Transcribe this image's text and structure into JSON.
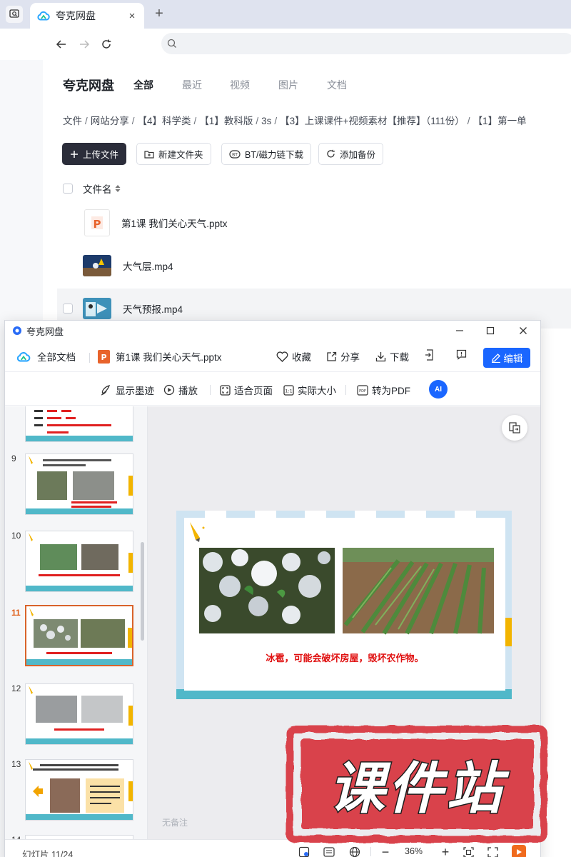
{
  "browser": {
    "tab_title": "夸克网盘",
    "tab_close": "×",
    "new_tab": "+"
  },
  "page": {
    "brand": "夸克网盘",
    "tabs": [
      "全部",
      "最近",
      "视频",
      "图片",
      "文档"
    ],
    "breadcrumb": [
      "文件",
      "网站分享",
      "【4】科学类",
      "【1】教科版",
      "3s",
      "【3】上课课件+视频素材【推荐】（111份）",
      "【1】第一单"
    ],
    "actions": {
      "upload": "上传文件",
      "new_folder": "新建文件夹",
      "bt": "BT/磁力链下载",
      "backup": "添加备份"
    },
    "file_header": "文件名",
    "files": [
      {
        "name": "第1课 我们关心天气.pptx",
        "type": "pptx"
      },
      {
        "name": "大气层.mp4",
        "type": "video"
      },
      {
        "name": "天气预报.mp4",
        "type": "video"
      }
    ]
  },
  "viewer": {
    "window_title": "夸克网盘",
    "all_docs": "全部文档",
    "file_name": "第1课 我们关心天气.pptx",
    "favorite": "收藏",
    "share": "分享",
    "download": "下载",
    "edit": "编辑",
    "toolbar2": {
      "ink": "显示墨迹",
      "play": "播放",
      "fit": "适合页面",
      "actual": "实际大小",
      "to_pdf": "转为PDF",
      "ai": "AI"
    },
    "slides": [
      {
        "num": "9",
        "caption": "台风会摧毁树木和房屋，会给人们的生命安全造成威胁。"
      },
      {
        "num": "10",
        "caption": "暴雨可能会造成洪涝，使农作物被淹，危害交通。"
      },
      {
        "num": "11",
        "caption": "冰雹，可能会破坏房屋，毁坏农作物。"
      },
      {
        "num": "12",
        "caption": "大雾，给交通出行造成安全隐患。"
      },
      {
        "num": "13",
        "caption": "了解天气的变化及发展规律，科学家在不停地观察。"
      },
      {
        "num": "14",
        "caption": ""
      }
    ],
    "current_slide_caption": "冰雹，可能会破坏房屋，毁坏农作物。",
    "no_notes": "无备注",
    "status": "幻灯片 11/24",
    "zoom": "36%",
    "zoom_minus": "−",
    "zoom_plus": "+"
  },
  "watermark": {
    "text": "课件站"
  },
  "colors": {
    "accent": "#1a66ff",
    "dark_button": "#2b2d3a",
    "active_thumb": "#d9632b",
    "caption_red": "#e01010",
    "watermark_red": "#d9434c"
  }
}
